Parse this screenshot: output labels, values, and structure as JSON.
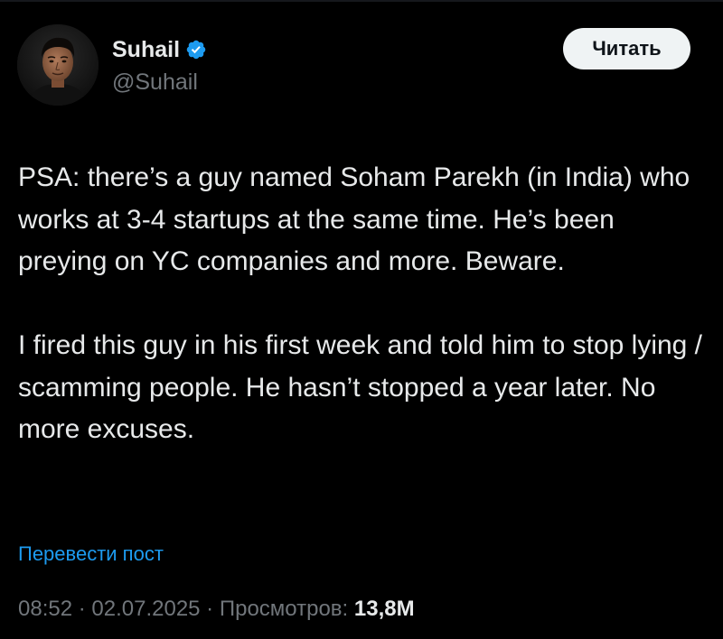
{
  "author": {
    "display_name": "Suhail",
    "handle": "@Suhail",
    "verified": true
  },
  "actions": {
    "read_label": "Читать"
  },
  "tweet": {
    "paragraphs": [
      "PSA: there’s a guy named Soham Parekh (in India) who works at 3-4 startups at the same time. He’s been preying on YC companies and more. Beware.",
      "I fired this guy in his first week and told him to stop lying / scamming people. He hasn’t stopped a year later. No more excuses."
    ],
    "translate_label": "Перевести пост",
    "time": "08:52",
    "separator": " · ",
    "date": "02.07.2025",
    "views_label": "Просмотров:",
    "views_count": "13,8M"
  },
  "icons": {
    "verified": "verified-badge-icon",
    "avatar": "profile-photo"
  },
  "colors": {
    "background": "#000000",
    "text_primary": "#e7e9ea",
    "text_secondary": "#71767b",
    "link": "#1d9bf0",
    "verified": "#1d9bf0",
    "button_bg": "#eff3f4",
    "button_text": "#0f1419"
  }
}
